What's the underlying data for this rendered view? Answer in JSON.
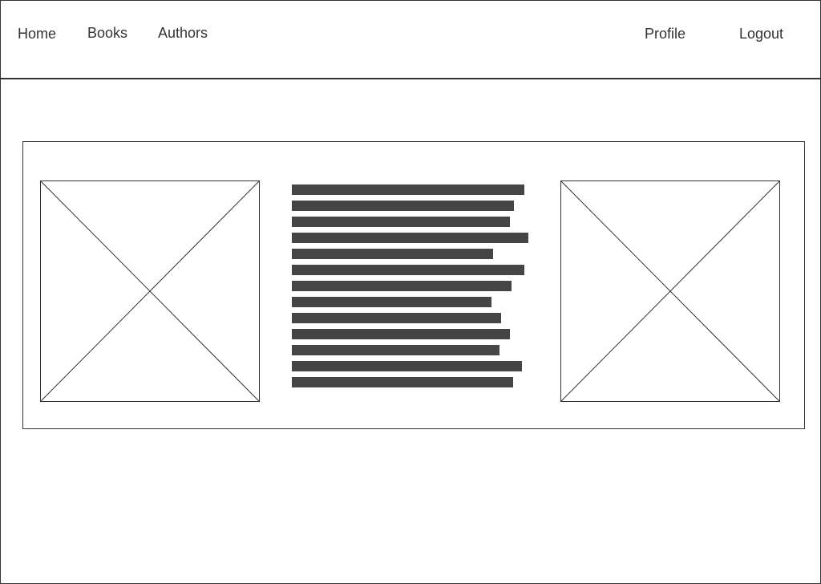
{
  "nav": {
    "left": [
      {
        "label": "Home"
      },
      {
        "label": "Books"
      },
      {
        "label": "Authors"
      }
    ],
    "right": [
      {
        "label": "Profile"
      },
      {
        "label": "Logout"
      }
    ]
  },
  "content": {
    "left_image": {
      "icon": "image-placeholder-icon"
    },
    "right_image": {
      "icon": "image-placeholder-icon"
    },
    "text_placeholder_lines": 13
  },
  "colors": {
    "stroke": "#333333",
    "text_bar": "#454545",
    "background": "#ffffff"
  }
}
